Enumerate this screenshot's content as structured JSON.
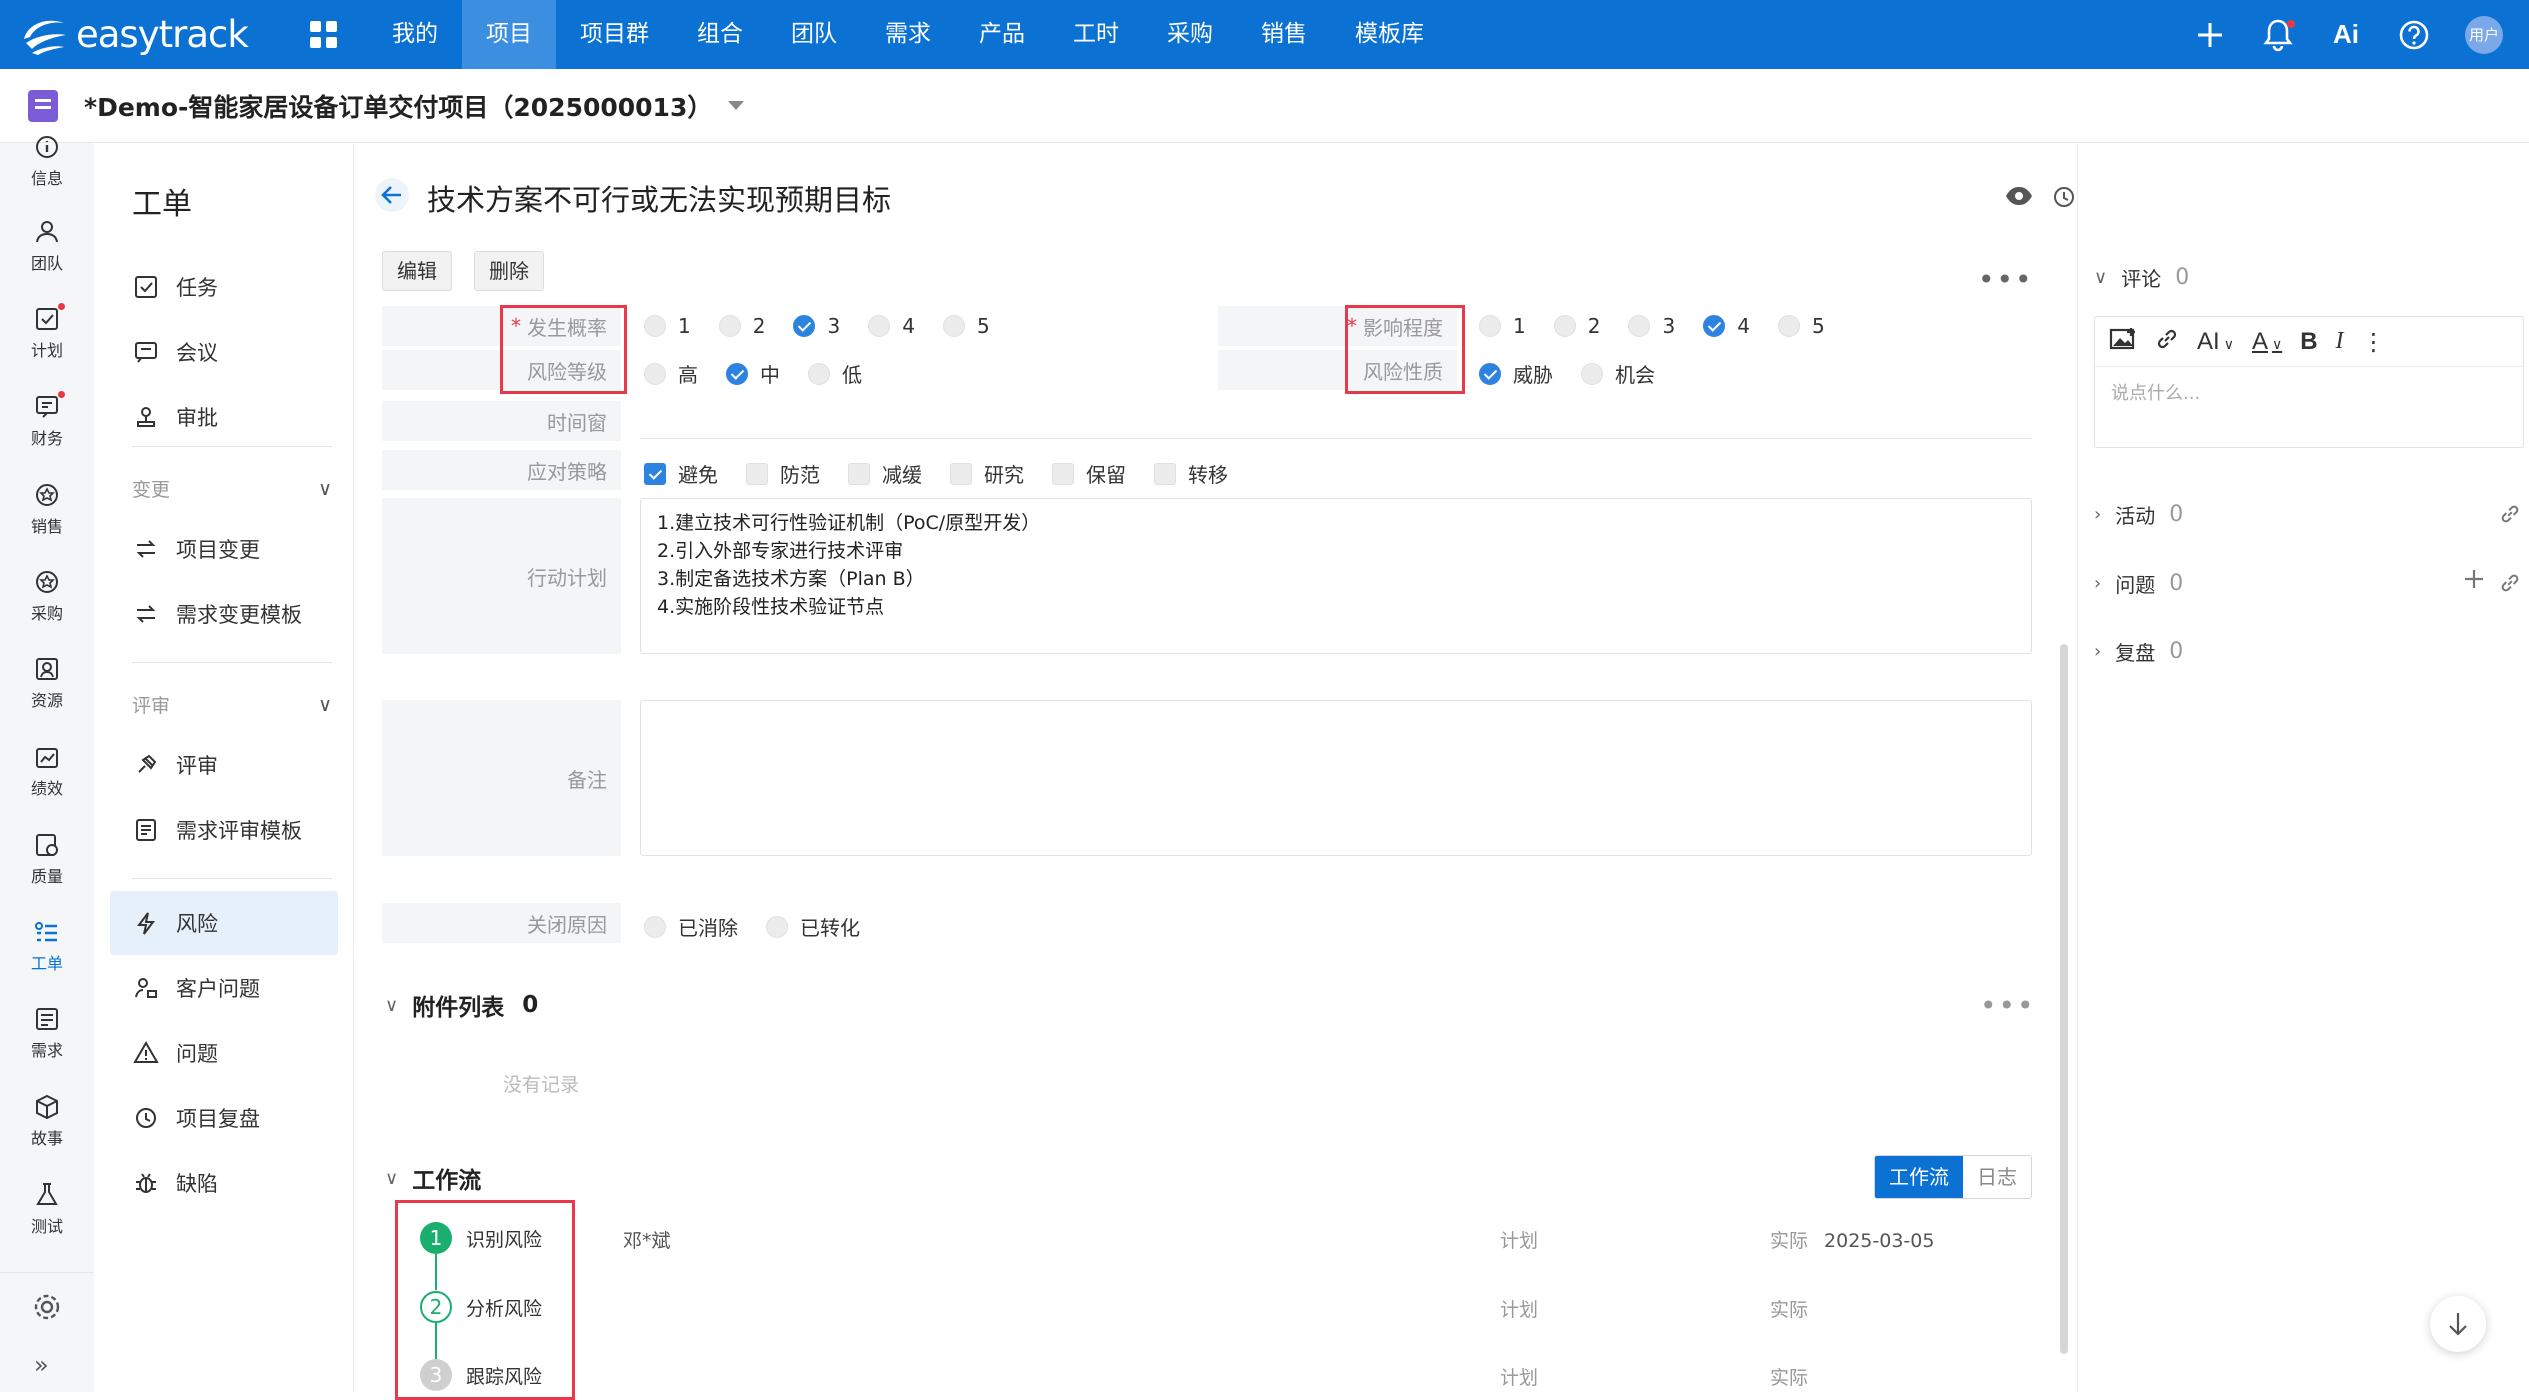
{
  "brand": {
    "name": "easytrack",
    "color": "#0b72d4"
  },
  "nav": [
    "我的",
    "项目",
    "项目群",
    "组合",
    "团队",
    "需求",
    "产品",
    "工时",
    "采购",
    "销售",
    "模板库"
  ],
  "nav_active_index": 1,
  "user": {
    "avatar_label": "用户"
  },
  "project": {
    "title": "*Demo-智能家居设备订单交付项目（2025000013）"
  },
  "rail": [
    {
      "label": "信息",
      "icon": "info-icon"
    },
    {
      "label": "团队",
      "icon": "team-icon"
    },
    {
      "label": "计划",
      "icon": "plan-icon",
      "dot": true
    },
    {
      "label": "财务",
      "icon": "finance-icon",
      "dot": true
    },
    {
      "label": "销售",
      "icon": "sales-icon"
    },
    {
      "label": "采购",
      "icon": "purchase-icon"
    },
    {
      "label": "资源",
      "icon": "resource-icon"
    },
    {
      "label": "绩效",
      "icon": "performance-icon"
    },
    {
      "label": "质量",
      "icon": "quality-icon"
    },
    {
      "label": "工单",
      "icon": "workorder-icon",
      "active": true
    },
    {
      "label": "需求",
      "icon": "requirement-icon"
    },
    {
      "label": "故事",
      "icon": "story-icon"
    },
    {
      "label": "测试",
      "icon": "test-icon"
    }
  ],
  "submenu": {
    "title": "工单",
    "items_top": [
      "任务",
      "会议",
      "审批"
    ],
    "group_change": "变更",
    "items_change": [
      "项目变更",
      "需求变更模板"
    ],
    "group_review": "评审",
    "items_review": [
      "评审",
      "需求评审模板"
    ],
    "items_bottom": [
      "风险",
      "客户问题",
      "问题",
      "项目复盘",
      "缺陷"
    ],
    "active": "风险"
  },
  "detail": {
    "title": "技术方案不可行或无法实现预期目标",
    "edit_label": "编辑",
    "delete_label": "删除",
    "probability": {
      "label": "发生概率",
      "options": [
        "1",
        "2",
        "3",
        "4",
        "5"
      ],
      "selected": "3"
    },
    "impact": {
      "label": "影响程度",
      "options": [
        "1",
        "2",
        "3",
        "4",
        "5"
      ],
      "selected": "4"
    },
    "risk_level": {
      "label": "风险等级",
      "options": [
        "高",
        "中",
        "低"
      ],
      "selected": "中"
    },
    "risk_nature": {
      "label": "风险性质",
      "options": [
        "威胁",
        "机会"
      ],
      "selected": "威胁"
    },
    "time_window": {
      "label": "时间窗"
    },
    "strategy": {
      "label": "应对策略",
      "options": [
        "避免",
        "防范",
        "减缓",
        "研究",
        "保留",
        "转移"
      ],
      "selected": "避免"
    },
    "action_plan": {
      "label": "行动计划",
      "lines": [
        "1.建立技术可行性验证机制（PoC/原型开发）",
        "2.引入外部专家进行技术评审",
        "3.制定备选技术方案（Plan B）",
        "4.实施阶段性技术验证节点"
      ]
    },
    "remark": {
      "label": "备注"
    },
    "close_reason": {
      "label": "关闭原因",
      "options": [
        "已消除",
        "已转化"
      ]
    }
  },
  "attachments": {
    "title": "附件列表",
    "count": "0",
    "empty": "没有记录"
  },
  "workflow": {
    "title": "工作流",
    "tab_workflow": "工作流",
    "tab_log": "日志",
    "plan_label": "计划",
    "actual_label": "实际",
    "steps": [
      {
        "num": "1",
        "name": "识别风险",
        "owner": "邓*斌",
        "actual": "2025-03-05"
      },
      {
        "num": "2",
        "name": "分析风险",
        "owner": "",
        "actual": ""
      },
      {
        "num": "3",
        "name": "跟踪风险",
        "owner": "",
        "actual": ""
      }
    ]
  },
  "right": {
    "comments": {
      "label": "评论",
      "count": "0"
    },
    "placeholder": "说点什么...",
    "activity": {
      "label": "活动",
      "count": "0"
    },
    "issues": {
      "label": "问题",
      "count": "0"
    },
    "review": {
      "label": "复盘",
      "count": "0"
    }
  }
}
